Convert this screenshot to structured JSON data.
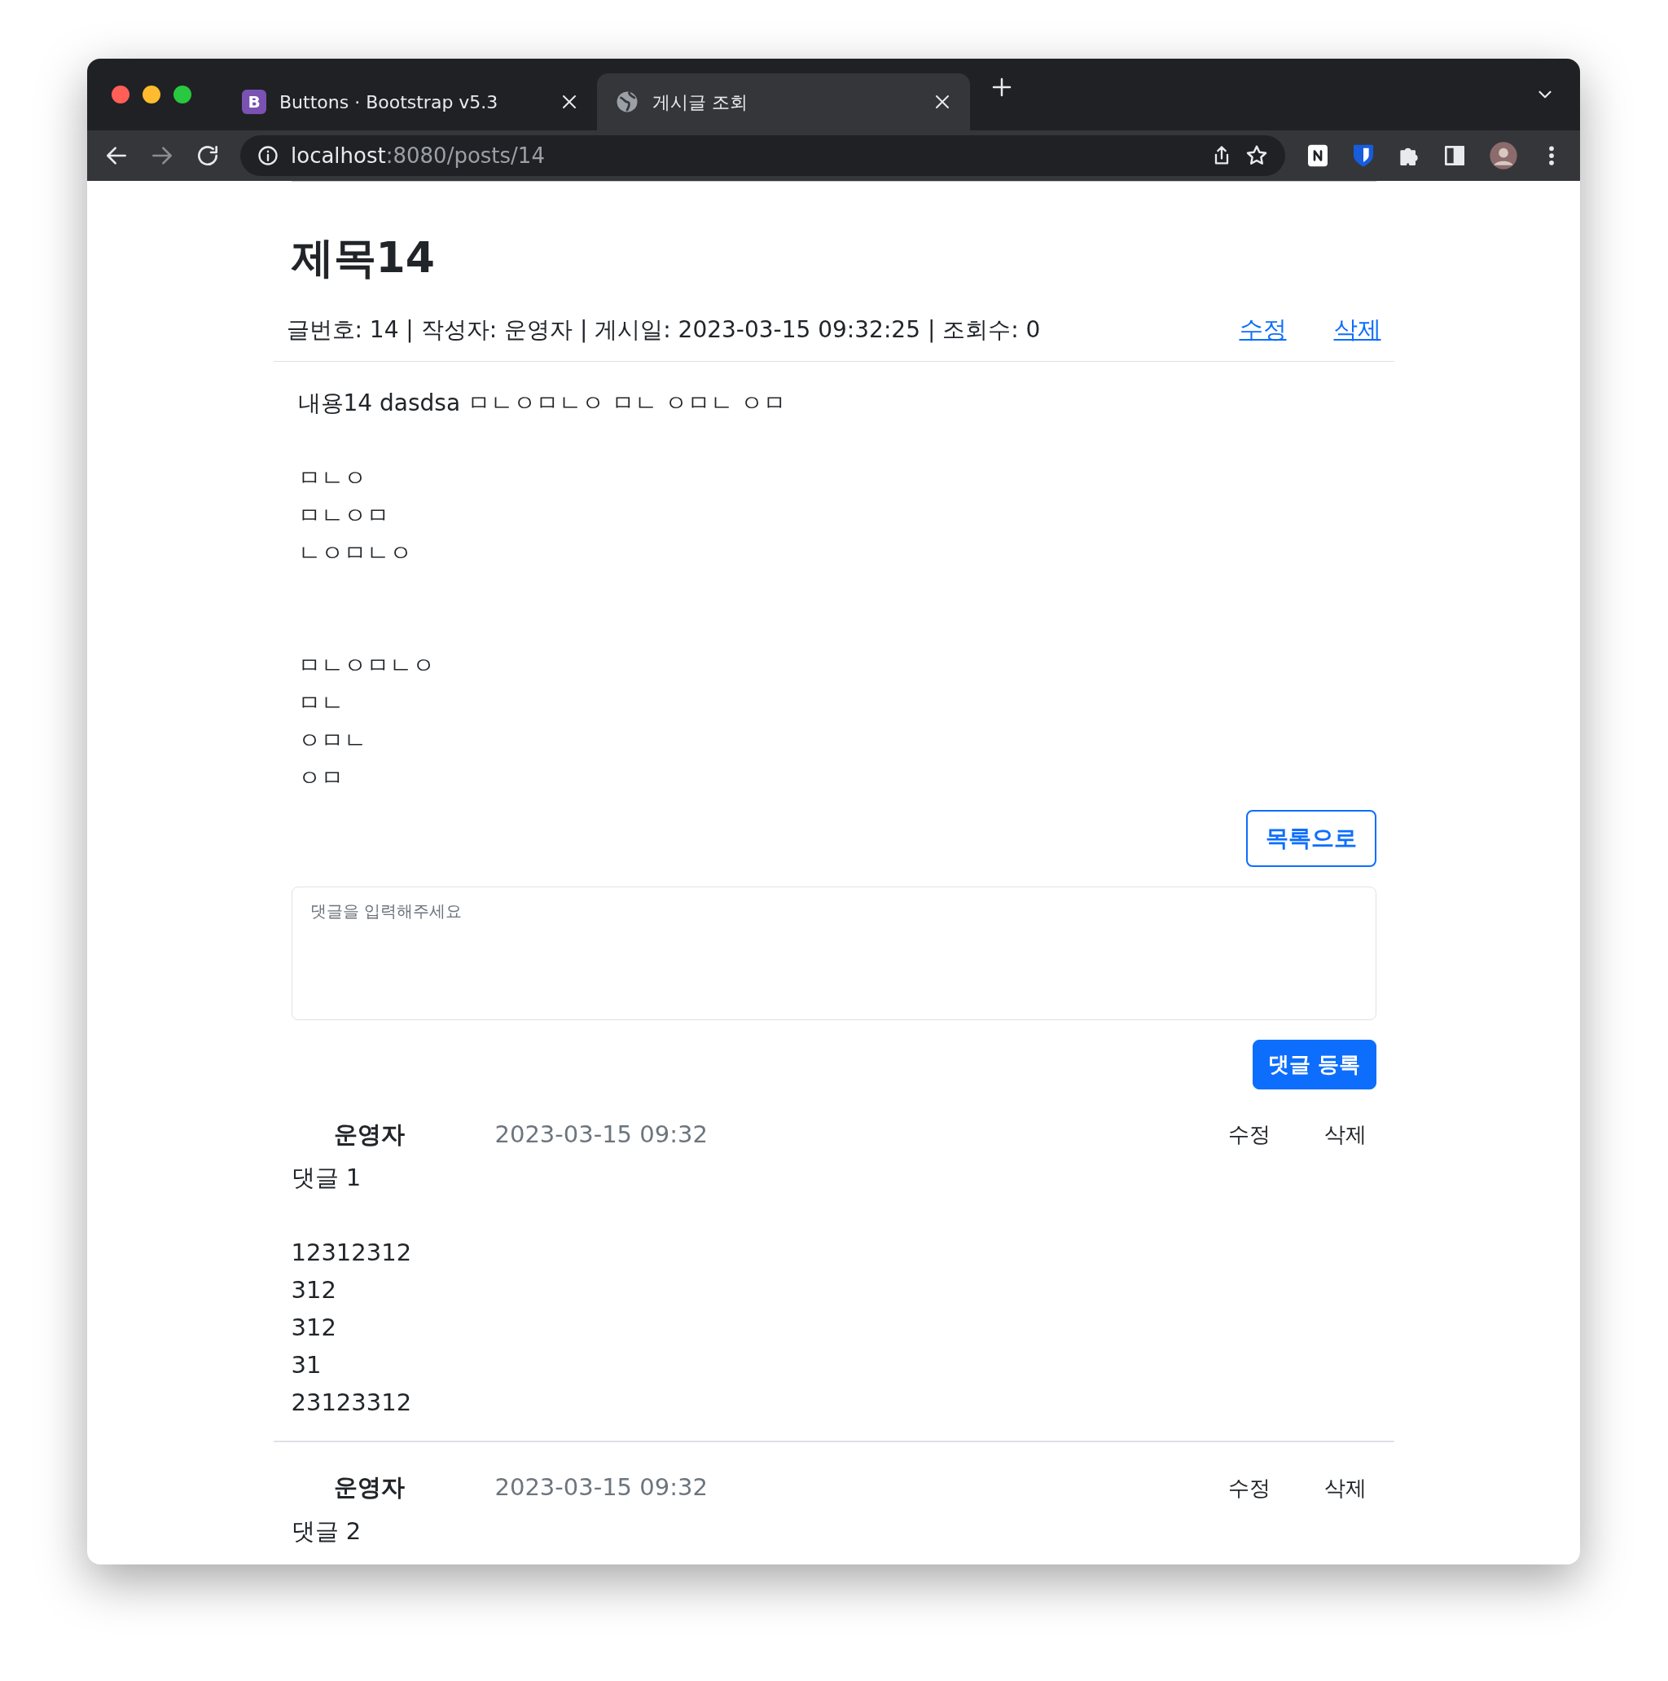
{
  "browser": {
    "tabs": [
      {
        "title": "Buttons · Bootstrap v5.3",
        "logo": "B",
        "kind": "bootstrap",
        "selected": false
      },
      {
        "title": "게시글 조회",
        "kind": "globe",
        "selected": true
      }
    ],
    "address": {
      "host": "localhost",
      "rest": ":8080/posts/14"
    }
  },
  "post": {
    "title": "제목14",
    "meta": "글번호: 14 | 작성자: 운영자 | 게시일: 2023-03-15 09:32:25 | 조회수: 0",
    "actions": [
      "수정",
      "삭제"
    ],
    "body": [
      {
        "kind": "text",
        "text": "내용14 dasdsa ㅁㄴㅇㅁㄴㅇ ㅁㄴ ㅇㅁㄴ ㅇㅁ"
      },
      {
        "kind": "blank"
      },
      {
        "kind": "text",
        "text": "ㅁㄴㅇ"
      },
      {
        "kind": "text",
        "text": "ㅁㄴㅇㅁ"
      },
      {
        "kind": "text",
        "text": "ㄴㅇㅁㄴㅇ"
      },
      {
        "kind": "blank"
      },
      {
        "kind": "blank"
      },
      {
        "kind": "text",
        "text": "ㅁㄴㅇㅁㄴㅇ"
      },
      {
        "kind": "text",
        "text": "ㅁㄴ"
      },
      {
        "kind": "text",
        "text": "ㅇㅁㄴ"
      },
      {
        "kind": "text",
        "text": "ㅇㅁ"
      }
    ],
    "list_button": "목록으로"
  },
  "comment_form": {
    "placeholder": "댓글을 입력해주세요",
    "submit": "댓글 등록"
  },
  "comments": [
    {
      "author": "운영자",
      "date": "2023-03-15 09:32",
      "actions": [
        "수정",
        "삭제"
      ],
      "body": [
        {
          "kind": "text",
          "text": "댓글 1"
        },
        {
          "kind": "blank"
        },
        {
          "kind": "text",
          "text": "12312312"
        },
        {
          "kind": "text",
          "text": "312"
        },
        {
          "kind": "text",
          "text": "312"
        },
        {
          "kind": "text",
          "text": "31"
        },
        {
          "kind": "text",
          "text": "23123312"
        }
      ]
    },
    {
      "author": "운영자",
      "date": "2023-03-15 09:32",
      "actions": [
        "수정",
        "삭제"
      ],
      "body": [
        {
          "kind": "text",
          "text": "댓글 2"
        }
      ]
    }
  ]
}
